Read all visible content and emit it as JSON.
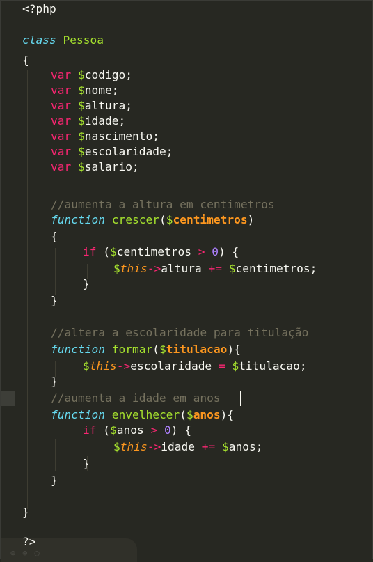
{
  "code": {
    "open_tag": "<?php",
    "close_tag": "?>",
    "class_kw": "class",
    "class_name": "Pessoa",
    "open_brace": "{",
    "close_brace": "}",
    "var_kw": "var",
    "props": [
      "codigo",
      "nome",
      "altura",
      "idade",
      "nascimento",
      "escolaridade",
      "salario"
    ],
    "comments": [
      "//aumenta a altura em centimetros",
      "//altera a escolaridade para titulação",
      "//aumenta a idade em anos"
    ],
    "function_kw": "function",
    "if_kw": "if",
    "this_kw": "this",
    "functions": [
      {
        "name": "crescer",
        "param": "centimetros",
        "prop": "altura",
        "op": "+="
      },
      {
        "name": "formar",
        "param": "titulacao",
        "prop": "escolaridade",
        "op": "="
      },
      {
        "name": "envelhecer",
        "param": "anos",
        "prop": "idade",
        "op": "+="
      }
    ],
    "zero": "0",
    "gt": ">"
  },
  "colors": {
    "background": "#272822",
    "keyword": "#f92672",
    "storage": "#66d9ef",
    "name": "#a6e22e",
    "parameter": "#fd971f",
    "number": "#ae81ff",
    "comment": "#75715e"
  },
  "icons": [
    "line-col-indicator",
    "search-icon",
    "settings-icon",
    "more-icon"
  ]
}
